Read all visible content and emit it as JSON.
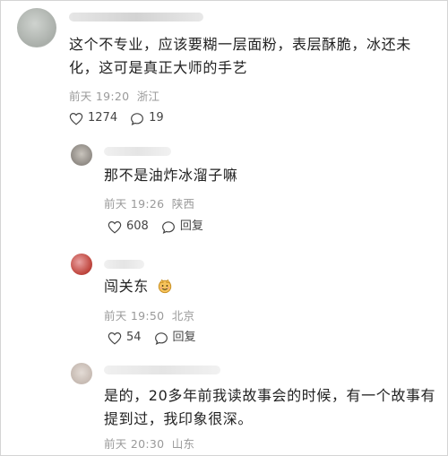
{
  "colors": {
    "meta": "#9a9a9a",
    "text": "#222222",
    "icon": "#444444"
  },
  "comments": [
    {
      "text": "这个不专业，应该要糊一层面粉，表层酥脆，冰还未化，这可是真正大师的手艺",
      "time": "前天 19:20",
      "location": "浙江",
      "likes": "1274",
      "replies": "19"
    },
    {
      "text": "那不是油炸冰溜子嘛",
      "time": "前天 19:26",
      "location": "陕西",
      "likes": "608",
      "reply_label": "回复"
    },
    {
      "text": "闯关东",
      "emoji": "emoji-face",
      "time": "前天 19:50",
      "location": "北京",
      "likes": "54",
      "reply_label": "回复"
    },
    {
      "text": "是的，20多年前我读故事会的时候，有一个故事有提到过，我印象很深。",
      "time": "前天 20:30",
      "location": "山东"
    }
  ]
}
